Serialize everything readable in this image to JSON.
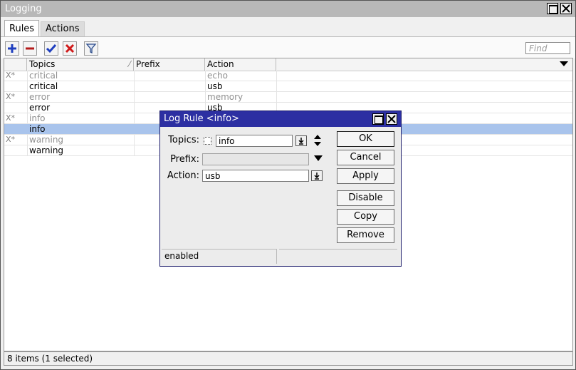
{
  "window": {
    "title": "Logging"
  },
  "tabs": [
    {
      "label": "Rules"
    },
    {
      "label": "Actions"
    }
  ],
  "toolbar": {
    "find_placeholder": "Find"
  },
  "table": {
    "columns": [
      "Topics",
      "Prefix",
      "Action"
    ],
    "rows": [
      {
        "flag": "X*",
        "topics": "critical",
        "prefix": "",
        "action": "echo",
        "disabled": true,
        "selected": false
      },
      {
        "flag": "",
        "topics": "critical",
        "prefix": "",
        "action": "usb",
        "disabled": false,
        "selected": false
      },
      {
        "flag": "X*",
        "topics": "error",
        "prefix": "",
        "action": "memory",
        "disabled": true,
        "selected": false
      },
      {
        "flag": "",
        "topics": "error",
        "prefix": "",
        "action": "usb",
        "disabled": false,
        "selected": false
      },
      {
        "flag": "X*",
        "topics": "info",
        "prefix": "",
        "action": "",
        "disabled": true,
        "selected": false
      },
      {
        "flag": "",
        "topics": "info",
        "prefix": "",
        "action": "",
        "disabled": false,
        "selected": true
      },
      {
        "flag": "X*",
        "topics": "warning",
        "prefix": "",
        "action": "",
        "disabled": true,
        "selected": false
      },
      {
        "flag": "",
        "topics": "warning",
        "prefix": "",
        "action": "",
        "disabled": false,
        "selected": false
      }
    ]
  },
  "status": "8 items (1 selected)",
  "dialog": {
    "title": "Log Rule <info>",
    "topics_label": "Topics:",
    "topics_value": "info",
    "prefix_label": "Prefix:",
    "prefix_value": "",
    "action_label": "Action:",
    "action_value": "usb",
    "buttons": [
      "OK",
      "Cancel",
      "Apply",
      "Disable",
      "Copy",
      "Remove"
    ],
    "status": "enabled"
  },
  "colors": {
    "selection": "#a9c4ec",
    "dialog_title": "#2c2fa2",
    "add": "#1f3fbf",
    "remove": "#b51a1a"
  }
}
